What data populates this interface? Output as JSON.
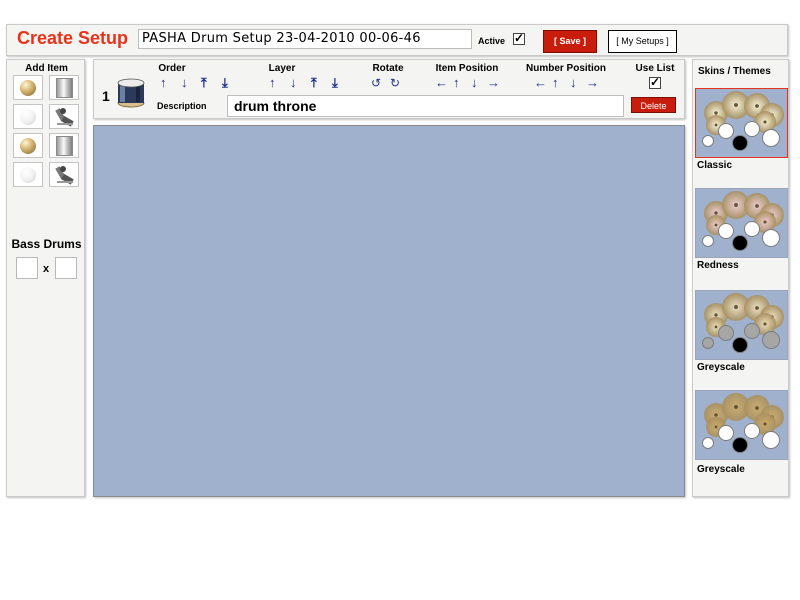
{
  "header": {
    "title": "Create Setup",
    "setup_name": "PASHA Drum Setup 23-04-2010 00-06-46",
    "active_label": "Active",
    "active_checked": true,
    "save_label": "[ Save ]",
    "my_setups_label": "[ My Setups ]"
  },
  "left_panel": {
    "add_item_title": "Add Item",
    "add_items": [
      {
        "icon": "gold-cymbal-icon"
      },
      {
        "icon": "chrome-drum-icon"
      },
      {
        "icon": "white-drum-icon"
      },
      {
        "icon": "bass-pedal-icon"
      },
      {
        "icon": "gold-cymbal-icon"
      },
      {
        "icon": "chrome-drum-icon"
      },
      {
        "icon": "white-drum-icon"
      },
      {
        "icon": "bass-pedal-icon"
      }
    ],
    "bass_drums_title": "Bass Drums",
    "bass_drums_separator": "x",
    "bass_drums_value_1": "",
    "bass_drums_value_2": ""
  },
  "controls": {
    "item_number": "1",
    "order_label": "Order",
    "layer_label": "Layer",
    "rotate_label": "Rotate",
    "item_position_label": "Item Position",
    "number_position_label": "Number Position",
    "use_list_label": "Use List",
    "use_list_checked": true,
    "description_label": "Description",
    "description_value": "drum throne",
    "delete_label": "Delete",
    "glyphs": {
      "up": "↑",
      "down": "↓",
      "top": "⤒",
      "bottom": "⤓",
      "left": "←",
      "right": "→",
      "rotate_ccw": "↺",
      "rotate_cw": "↻",
      "check": "✓"
    }
  },
  "skins": {
    "title": "Skins / Themes",
    "selected_index": 0,
    "items": [
      {
        "label": "Classic",
        "cymbal_color": "#efe6c4",
        "drum_color": "#ffffff"
      },
      {
        "label": "Redness",
        "cymbal_color": "#e7c4bc",
        "drum_color": "#ffffff"
      },
      {
        "label": "Greyscale",
        "cymbal_color": "#e5d5b0",
        "drum_color": "#a6a6a6"
      },
      {
        "label": "Greyscale",
        "cymbal_color": "#c9a868",
        "drum_color": "#ffffff"
      }
    ]
  },
  "colors": {
    "accent_red": "#e8331a",
    "button_red": "#c81d0c",
    "canvas_blue": "#9fb1cc",
    "arrow_blue": "#1f2f8f"
  }
}
